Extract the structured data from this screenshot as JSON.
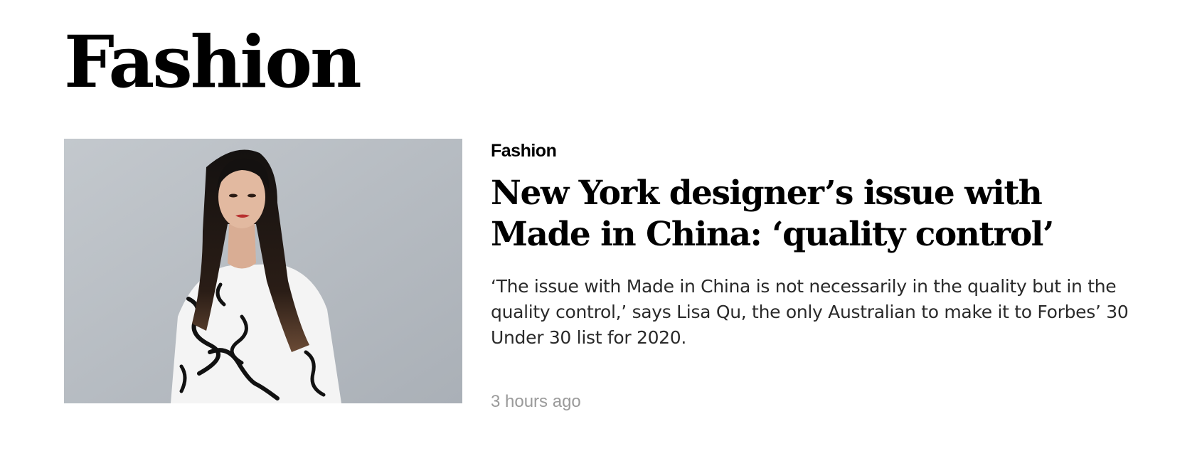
{
  "section": {
    "title": "Fashion"
  },
  "article": {
    "category": "Fashion",
    "headline": "New York designer’s issue with Made in China: ‘quality control’",
    "summary": "‘The issue with Made in China is not necessarily in the quality but in the quality control,’ says Lisa Qu, the only Australian to make it to Forbes’ 30 Under 30 list for 2020.",
    "timestamp": "3 hours ago",
    "image": {
      "alt": "Portrait of a woman with long dark hair in a black-and-white patterned top",
      "background_color": "#b7bcc2"
    }
  }
}
